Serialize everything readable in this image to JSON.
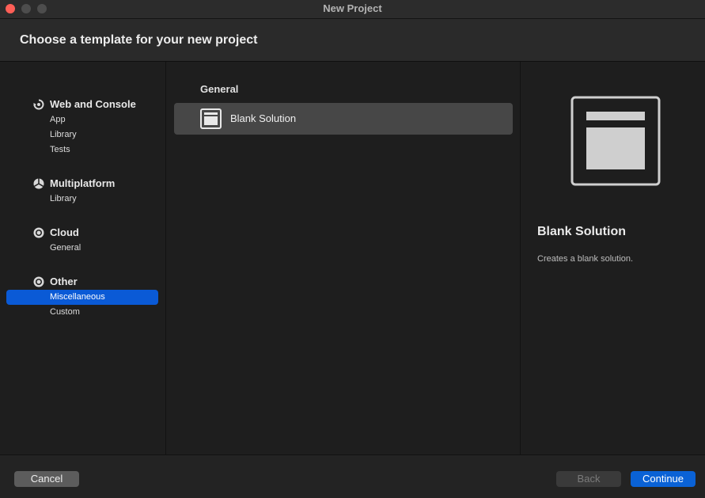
{
  "window": {
    "title": "New Project"
  },
  "header": {
    "title": "Choose a template for your new project"
  },
  "sidebar": {
    "categories": [
      {
        "title": "Web and Console",
        "icon": "web-console-icon",
        "items": [
          "App",
          "Library",
          "Tests"
        ]
      },
      {
        "title": "Multiplatform",
        "icon": "multiplatform-icon",
        "items": [
          "Library"
        ]
      },
      {
        "title": "Cloud",
        "icon": "cloud-icon",
        "items": [
          "General"
        ]
      },
      {
        "title": "Other",
        "icon": "other-icon",
        "items": [
          "Miscellaneous",
          "Custom"
        ],
        "selected_item": "Miscellaneous"
      }
    ]
  },
  "templates": {
    "group_title": "General",
    "items": [
      {
        "label": "Blank Solution",
        "icon": "blank-solution-icon",
        "selected": true
      }
    ]
  },
  "detail": {
    "title": "Blank Solution",
    "description": "Creates a blank solution.",
    "icon": "blank-solution-preview-icon"
  },
  "footer": {
    "cancel_label": "Cancel",
    "back_label": "Back",
    "continue_label": "Continue"
  },
  "colors": {
    "accent": "#0a5ad6",
    "window_bg": "#1e1e1e",
    "selected_row": "#474747",
    "close_dot": "#ff5f57"
  }
}
